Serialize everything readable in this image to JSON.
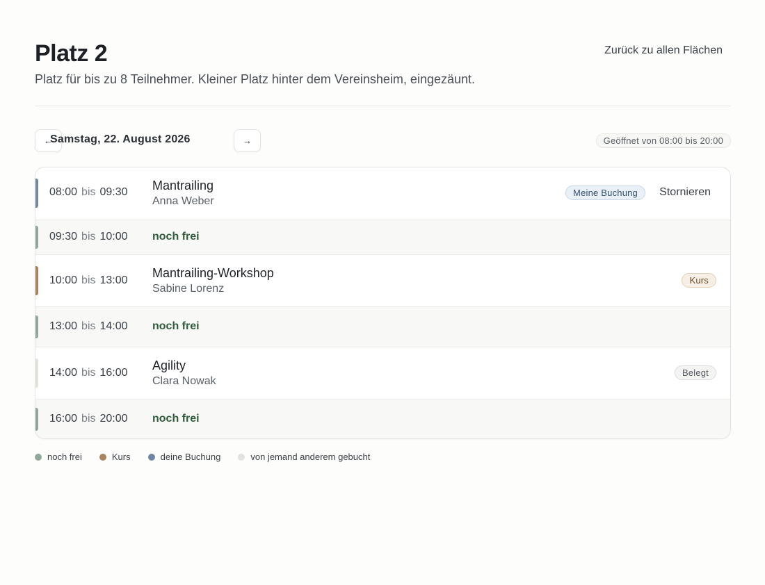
{
  "header": {
    "title": "Platz 2",
    "subtitle": "Platz für bis zu 8 Teilnehmer. Kleiner Platz hinter dem Vereinsheim, eingezäunt.",
    "back_link": "Zurück zu allen Flächen"
  },
  "datebar": {
    "prev_icon": "←",
    "next_icon": "→",
    "date": "Samstag, 22. August 2026",
    "opening_hours": "Geöffnet von 08:00 bis 20:00"
  },
  "time_separator": "bis",
  "slots": [
    {
      "start": "08:00",
      "end": "09:30",
      "title": "Mantrailing",
      "subtitle": "Anna Weber",
      "badge": "Meine Buchung",
      "action": "Stornieren",
      "status": "mine"
    },
    {
      "start": "09:30",
      "end": "10:00",
      "free_label": "noch frei",
      "status": "free"
    },
    {
      "start": "10:00",
      "end": "13:00",
      "title": "Mantrailing-Workshop",
      "subtitle": "Sabine Lorenz",
      "badge": "Kurs",
      "status": "course"
    },
    {
      "start": "13:00",
      "end": "14:00",
      "free_label": "noch frei",
      "status": "free"
    },
    {
      "start": "14:00",
      "end": "16:00",
      "title": "Agility",
      "subtitle": "Clara Nowak",
      "badge": "Belegt",
      "status": "taken"
    },
    {
      "start": "16:00",
      "end": "20:00",
      "free_label": "noch frei",
      "status": "free"
    }
  ],
  "legend": [
    {
      "label": "noch frei",
      "color": "#8fa89a"
    },
    {
      "label": "Kurs",
      "color": "#a8845e"
    },
    {
      "label": "deine Buchung",
      "color": "#6f87a3"
    },
    {
      "label": "von jemand anderem gebucht",
      "color": "#e2e2df"
    }
  ],
  "colors": {
    "free": "#8fa89a",
    "course": "#a8845e",
    "mine": "#6f87a3",
    "taken": "#e2e2df"
  }
}
